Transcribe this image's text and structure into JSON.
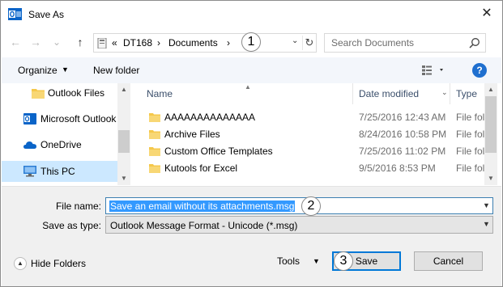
{
  "window": {
    "title": "Save As",
    "close_glyph": "✕"
  },
  "nav": {
    "back_glyph": "←",
    "forward_glyph": "→",
    "dropdown_glyph": "⌄",
    "up_glyph": "↑"
  },
  "address": {
    "overflow": "«",
    "segments": [
      "DT168",
      "Documents"
    ],
    "separator": "›",
    "refresh_glyph": "↻"
  },
  "search": {
    "placeholder": "Search Documents"
  },
  "toolbar": {
    "organize_label": "Organize",
    "new_folder_label": "New folder",
    "help_label": "?"
  },
  "sidebar": {
    "items": [
      {
        "label": "Outlook Files",
        "icon": "folder-icon"
      },
      {
        "label": "Microsoft Outlook",
        "icon": "outlook-icon"
      },
      {
        "label": "OneDrive",
        "icon": "onedrive-icon"
      },
      {
        "label": "This PC",
        "icon": "computer-icon"
      }
    ]
  },
  "columns": {
    "name": "Name",
    "date_modified": "Date modified",
    "type": "Type"
  },
  "files": [
    {
      "name": "AAAAAAAAAAAAAA",
      "date": "7/25/2016 12:43 AM",
      "type": "File fol"
    },
    {
      "name": "Archive Files",
      "date": "8/24/2016 10:58 PM",
      "type": "File fol"
    },
    {
      "name": "Custom Office Templates",
      "date": "7/25/2016 11:02 PM",
      "type": "File fol"
    },
    {
      "name": "Kutools for Excel",
      "date": "9/5/2016 8:53 PM",
      "type": "File fol"
    }
  ],
  "form": {
    "file_name_label": "File name:",
    "file_name_value": "Save an email without its attachments.msg",
    "save_as_type_label": "Save as type:",
    "save_as_type_value": "Outlook Message Format - Unicode (*.msg)"
  },
  "footer": {
    "hide_folders_label": "Hide Folders",
    "tools_label": "Tools",
    "save_label": "Save",
    "cancel_label": "Cancel"
  },
  "callouts": [
    "1",
    "2",
    "3"
  ],
  "colors": {
    "accent": "#0078d7",
    "selection": "#3399ff",
    "nav_selected": "#cce8ff",
    "folder": "#f5c84b",
    "help": "#1f6fcf"
  }
}
